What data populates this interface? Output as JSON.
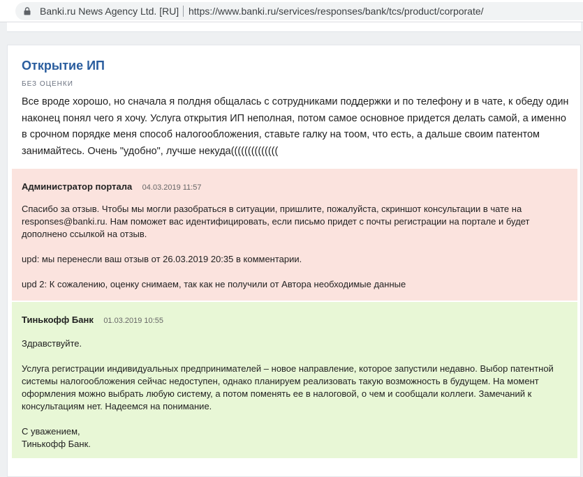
{
  "browser": {
    "site_name": "Banki.ru News Agency Ltd. [RU]",
    "url": "https://www.banki.ru/services/responses/bank/tcs/product/corporate/"
  },
  "review": {
    "title": "Открытие ИП",
    "rating": "БЕЗ ОЦЕНКИ",
    "text": "Все вроде хорошо, но сначала я полдня общалась с сотрудниками поддержки и по телефону и в чате, к обеду один наконец понял чего я хочу. Услуга открытия ИП неполная, потом самое основное придется делать самой, а именно в срочном порядке меня способ налогообложения, ставьте галку на тоом, что есть, а дальше своим патентом занимайтесь. Очень \"удобно\", лучше некуда(((((((((((((("
  },
  "admin_reply": {
    "author": "Администратор портала",
    "date": "04.03.2019 11:57",
    "paragraphs": [
      "Спасибо за отзыв. Чтобы мы могли разобраться в ситуации, пришлите, пожалуйста, скриншот консультации в чате на responses@banki.ru. Нам поможет вас идентифицировать, если письмо придет с почты регистрации на портале и будет дополнено ссылкой на отзыв.",
      "upd: мы перенесли ваш отзыв от 26.03.2019 20:35 в комментарии.",
      "upd 2: К сожалению, оценку снимаем, так как не получили от Автора необходимые данные"
    ]
  },
  "bank_reply": {
    "author": "Тинькофф Банк",
    "date": "01.03.2019 10:55",
    "paragraphs": [
      "Здравствуйте.",
      "Услуга регистрации индивидуальных предпринимателей – новое направление, которое запустили недавно. Выбор патентной системы налогообложения сейчас недоступен, однако планируем реализовать такую возможность в будущем. На момент оформления можно выбрать любую систему, а потом поменять ее в налоговой, о чем и сообщали коллеги. Замечаний к консультациям нет. Надеемся на понимание.",
      "С уважением,",
      "Тинькофф Банк."
    ]
  }
}
